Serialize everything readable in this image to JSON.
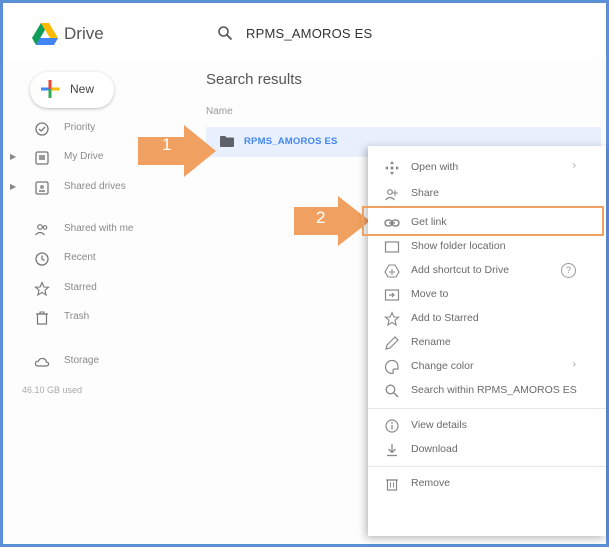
{
  "app": {
    "name": "Drive"
  },
  "search": {
    "value": "RPMS_AMOROS ES"
  },
  "sidebar": {
    "new_label": "New",
    "items": [
      {
        "label": "Priority",
        "icon": "check-circle-icon"
      },
      {
        "label": "My Drive",
        "icon": "my-drive-icon"
      },
      {
        "label": "Shared drives",
        "icon": "shared-drives-icon"
      },
      {
        "label": "Shared with me",
        "icon": "people-icon"
      },
      {
        "label": "Recent",
        "icon": "clock-icon"
      },
      {
        "label": "Starred",
        "icon": "star-icon"
      },
      {
        "label": "Trash",
        "icon": "trash-icon"
      },
      {
        "label": "Storage",
        "icon": "cloud-icon"
      }
    ],
    "storage_used": "46.10 GB used"
  },
  "main": {
    "results_title": "Search results",
    "column_name": "Name",
    "file": {
      "name": "RPMS_AMOROS ES",
      "icon": "folder-icon"
    }
  },
  "annotations": {
    "step1": "1",
    "step2": "2",
    "color": "#f0a060"
  },
  "context_menu": {
    "items": [
      {
        "label": "Open with",
        "right": "›",
        "icon": "open-with-icon"
      },
      {
        "label": "Share",
        "icon": "share-icon"
      },
      {
        "label": "Get link",
        "icon": "link-icon"
      },
      {
        "label": "Show folder location",
        "icon": "folder-location-icon"
      },
      {
        "label": "Add shortcut to Drive",
        "right": "?",
        "icon": "add-shortcut-icon"
      },
      {
        "label": "Move to",
        "icon": "move-to-icon"
      },
      {
        "label": "Add to Starred",
        "icon": "star-icon"
      },
      {
        "label": "Rename",
        "icon": "rename-icon"
      },
      {
        "label": "Change color",
        "right": "›",
        "icon": "palette-icon"
      },
      {
        "label": "Search within RPMS_AMOROS ES",
        "icon": "search-icon"
      },
      {
        "label": "View details",
        "icon": "info-icon"
      },
      {
        "label": "Download",
        "icon": "download-icon"
      },
      {
        "label": "Remove",
        "icon": "trash-icon"
      }
    ]
  },
  "colors": {
    "accent": "#4285f4",
    "selected_row": "#e8f0fe",
    "frame": "#5b8fd6"
  }
}
